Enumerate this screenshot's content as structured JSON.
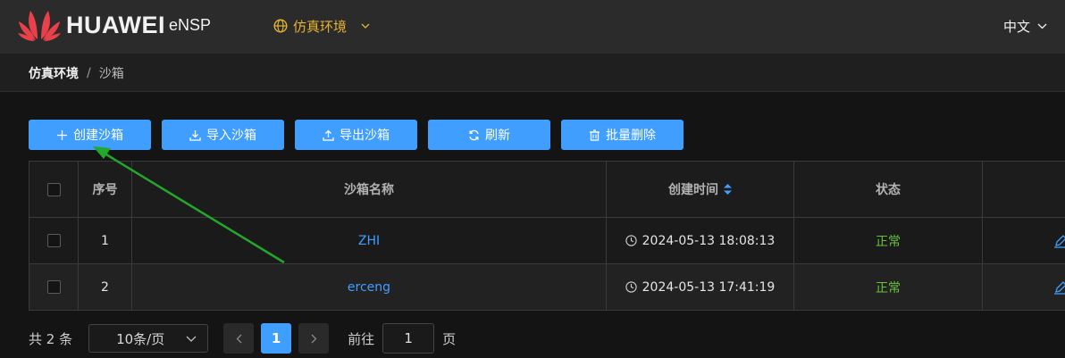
{
  "header": {
    "brand": "HUAWEI",
    "product": "eNSP",
    "env_menu": "仿真环境",
    "language": "中文"
  },
  "breadcrumb": {
    "root": "仿真环境",
    "separator": "/",
    "current": "沙箱"
  },
  "toolbar": {
    "create": "创建沙箱",
    "import": "导入沙箱",
    "export": "导出沙箱",
    "refresh": "刷新",
    "batch_delete": "批量删除"
  },
  "table": {
    "columns": {
      "index": "序号",
      "name": "沙箱名称",
      "created": "创建时间",
      "status": "状态"
    },
    "rows": [
      {
        "index": "1",
        "name": "ZHI",
        "created": "2024-05-13 18:08:13",
        "status": "正常"
      },
      {
        "index": "2",
        "name": "erceng",
        "created": "2024-05-13 17:41:19",
        "status": "正常"
      }
    ]
  },
  "pagination": {
    "total": "共 2 条",
    "page_size": "10条/页",
    "current_page": "1",
    "goto_label": "前往",
    "goto_value": "1",
    "page_unit": "页"
  },
  "colors": {
    "accent": "#409eff",
    "env_menu": "#e6b32e",
    "status_ok": "#67c23a",
    "annotation_arrow": "#22a82a"
  }
}
